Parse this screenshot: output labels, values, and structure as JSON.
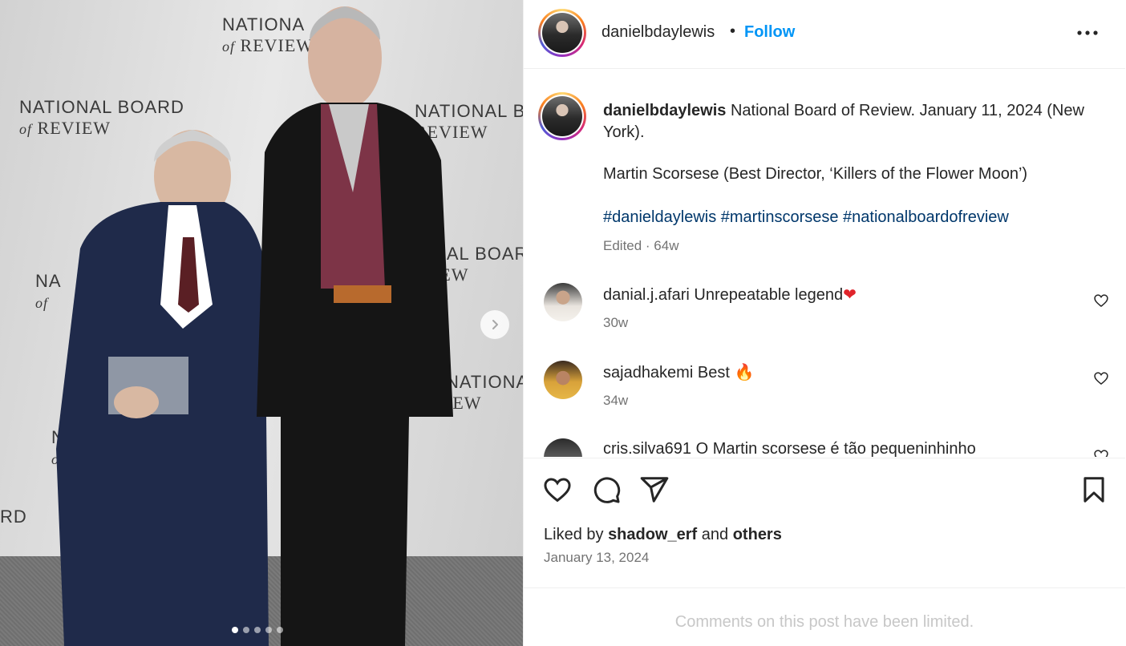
{
  "media": {
    "backdrop_logos": [
      {
        "line1": "NATIONAL BOARD",
        "line2_small": "of",
        "line2": "REVIEW"
      },
      {
        "line1": "NATIONA",
        "line2_small": "of",
        "line2": "REVIEW"
      },
      {
        "line1": "NATIONAL BOA",
        "line2_small": "",
        "line2": "REVIEW"
      },
      {
        "line1": "NATIONAL BOA",
        "line2_small": "",
        "line2": "IEW"
      },
      {
        "line1": "NAL BOARD",
        "line2_small": "",
        "line2": "IEW"
      },
      {
        "line1": "NATI",
        "line2_small": "of",
        "line2": "RE"
      },
      {
        "line1": "NA",
        "line2_small": "of",
        "line2": ""
      },
      {
        "line1": "RD",
        "line2_small": "",
        "line2": ""
      }
    ],
    "slide_count": 5,
    "active_slide": 1
  },
  "header": {
    "username": "danielbdaylewis",
    "separator": "•",
    "follow_label": "Follow"
  },
  "caption": {
    "username": "danielbdaylewis",
    "text": "National Board of Review. January 11, 2024 (New York).",
    "line2": "Martin Scorsese (Best Director, ‘Killers of the Flower Moon’)",
    "hashtags": [
      "#danieldaylewis",
      "#martinscorsese",
      "#nationalboardofreview"
    ],
    "meta": "Edited · 64w"
  },
  "comments": [
    {
      "username": "danial.j.afari",
      "text": "Unrepeatable legend",
      "emoji": "❤",
      "time": "30w"
    },
    {
      "username": "sajadhakemi",
      "text": "Best",
      "emoji": "🔥",
      "time": "34w"
    },
    {
      "username": "cris.silva691",
      "text": "O Martin scorsese é tão pequeninhinho",
      "emoji": "",
      "time": ""
    }
  ],
  "footer": {
    "liked_by_prefix": "Liked by",
    "liked_by_user": "shadow_erf",
    "liked_by_and": "and",
    "liked_by_others": "others",
    "date": "January 13, 2024",
    "comments_limited": "Comments on this post have been limited."
  },
  "colors": {
    "follow_blue": "#0095f6",
    "hashtag_blue": "#00376b",
    "muted_gray": "#737373",
    "heart_red": "#e0242b"
  }
}
